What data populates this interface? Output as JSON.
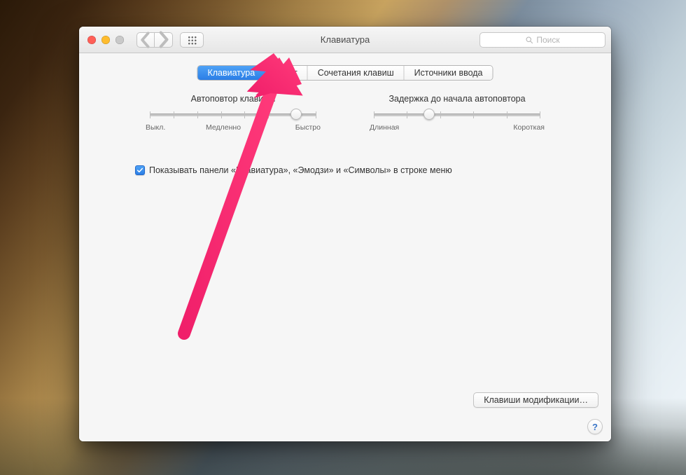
{
  "window": {
    "title": "Клавиатура",
    "search_placeholder": "Поиск"
  },
  "tabs": [
    {
      "label": "Клавиатура",
      "active": true
    },
    {
      "label": "Текст",
      "active": false
    },
    {
      "label": "Сочетания клавиш",
      "active": false
    },
    {
      "label": "Источники ввода",
      "active": false
    }
  ],
  "slider_repeat": {
    "label": "Автоповтор клавиши",
    "min_label": "Выкл.",
    "mid_label": "Медленно",
    "max_label": "Быстро",
    "value_pct": 88
  },
  "slider_delay": {
    "label": "Задержка до начала автоповтора",
    "min_label": "Длинная",
    "max_label": "Короткая",
    "value_pct": 33
  },
  "checkbox": {
    "checked": true,
    "label": "Показывать панели «Клавиатура», «Эмодзи» и «Символы» в строке меню"
  },
  "buttons": {
    "modifier_keys": "Клавиши модификации…"
  },
  "help_glyph": "?"
}
